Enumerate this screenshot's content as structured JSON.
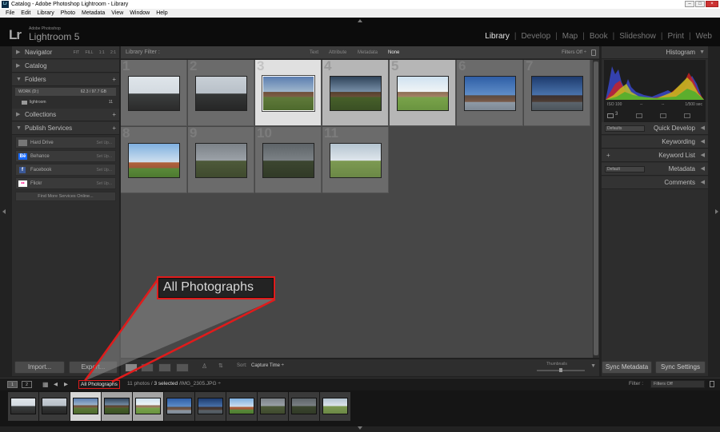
{
  "window": {
    "title": "Catalog - Adobe Photoshop Lightroom - Library",
    "icon": "Lr"
  },
  "menu": [
    "File",
    "Edit",
    "Library",
    "Photo",
    "Metadata",
    "View",
    "Window",
    "Help"
  ],
  "identity": {
    "logo": "Lr",
    "small": "Adobe Photoshop",
    "name": "Lightroom 5"
  },
  "modules": [
    {
      "label": "Library",
      "active": true
    },
    {
      "label": "Develop",
      "active": false
    },
    {
      "label": "Map",
      "active": false
    },
    {
      "label": "Book",
      "active": false
    },
    {
      "label": "Slideshow",
      "active": false
    },
    {
      "label": "Print",
      "active": false
    },
    {
      "label": "Web",
      "active": false
    }
  ],
  "left_panel": {
    "navigator": "Navigator",
    "navigator_zoom": [
      "FIT",
      "FILL",
      "1:1",
      "2:1"
    ],
    "catalog": "Catalog",
    "folders": "Folders",
    "volume": {
      "name": "WORK (D:)",
      "size": "62.3 / 97.7 GB"
    },
    "folder": {
      "name": "lightroom",
      "count": "11"
    },
    "collections": "Collections",
    "publish_services": "Publish Services",
    "services": [
      {
        "name": "Hard Drive",
        "icon": "hard-drive-icon",
        "action": "Set Up..."
      },
      {
        "name": "Behance",
        "icon": "Bē",
        "action": "Set Up..."
      },
      {
        "name": "Facebook",
        "icon": "f",
        "action": "Set Up..."
      },
      {
        "name": "Flickr",
        "icon": "••",
        "action": "Set Up..."
      }
    ],
    "find_more": "Find More Services Online...",
    "import": "Import...",
    "export": "Export..."
  },
  "filter_bar": {
    "title": "Library Filter :",
    "options": [
      "Text",
      "Attribute",
      "Metadata",
      "None"
    ],
    "active": "None",
    "filters_off": "Filters Off ÷"
  },
  "grid": [
    {
      "num": "1",
      "scene": "scn-tower",
      "state": ""
    },
    {
      "num": "2",
      "scene": "scn-tower2",
      "state": ""
    },
    {
      "num": "3",
      "scene": "scn-house",
      "state": "sel"
    },
    {
      "num": "4",
      "scene": "scn-house2",
      "state": "lsel"
    },
    {
      "num": "5",
      "scene": "scn-house3",
      "state": "lsel"
    },
    {
      "num": "6",
      "scene": "scn-town",
      "state": ""
    },
    {
      "num": "7",
      "scene": "scn-town2",
      "state": ""
    },
    {
      "num": "8",
      "scene": "scn-town3",
      "state": ""
    },
    {
      "num": "9",
      "scene": "scn-field",
      "state": ""
    },
    {
      "num": "10",
      "scene": "scn-field2",
      "state": ""
    },
    {
      "num": "11",
      "scene": "scn-field3",
      "state": ""
    }
  ],
  "callout": {
    "text": "All Photographs",
    "color": "#e01b1b"
  },
  "toolbar": {
    "sort_label": "Sort:",
    "sort_value": "Capture Time ÷",
    "thumbnails_label": "Thumbnails"
  },
  "right_panel": {
    "histogram": "Histogram",
    "hist_info": {
      "iso": "ISO 100",
      "mm": "--",
      "fstop": "--",
      "shutter": "1/500 sec"
    },
    "quick_develop": "Quick Develop",
    "qd_preset": "Defaults",
    "keywording": "Keywording",
    "keyword_list": "Keyword List",
    "metadata": "Metadata",
    "md_preset": "Default",
    "comments": "Comments",
    "sync_metadata": "Sync Metadata",
    "sync_settings": "Sync Settings"
  },
  "filmstrip_bar": {
    "source": "All Photographs",
    "count": "11 photos /",
    "selected": "3 selected",
    "file": "/IMG_2305.JPG ÷",
    "filter_label": "Filter :",
    "filter_value": "Filters Off"
  },
  "colors": {
    "accent": "#e01b1b",
    "panel": "#2d2d2d",
    "grid_bg": "#474747"
  }
}
